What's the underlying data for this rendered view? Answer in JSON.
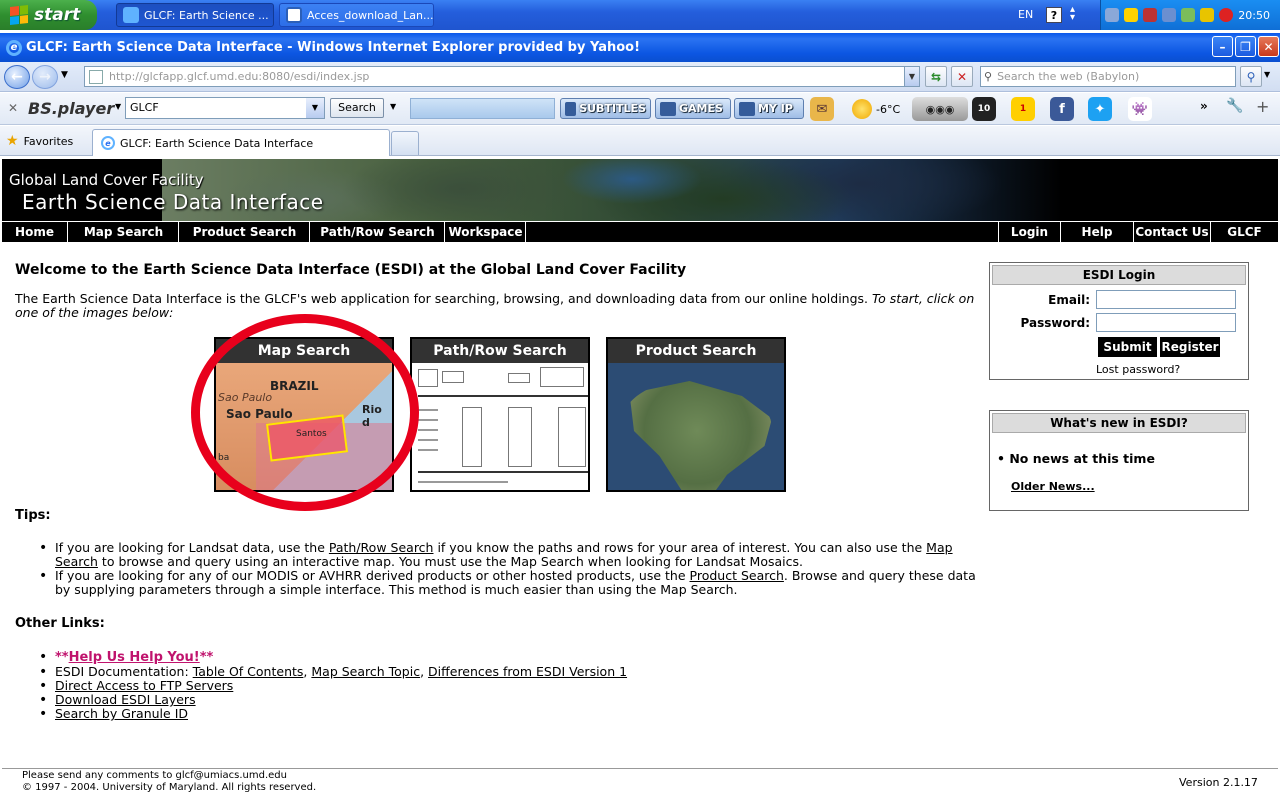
{
  "taskbar": {
    "start_label": "start",
    "buttons": [
      {
        "label": "GLCF: Earth Science ..."
      },
      {
        "label": "Acces_download_Lan..."
      }
    ],
    "language": "EN",
    "clock": "20:50"
  },
  "window": {
    "title": "GLCF: Earth Science Data Interface - Windows Internet Explorer provided by Yahoo!",
    "address": "http://glcfapp.glcf.umd.edu:8080/esdi/index.jsp",
    "web_search_placeholder": "Search the web (Babylon)",
    "tab_title": "GLCF: Earth Science Data Interface",
    "favorites_label": "Favorites"
  },
  "toolbar": {
    "player_label": "BS.player",
    "search_value": "GLCF",
    "search_button": "Search",
    "subtitles": "SUBTITLES",
    "games": "GAMES",
    "myip": "MY IP",
    "temperature": "-6°C",
    "badge1": "10",
    "badge2": "1"
  },
  "banner": {
    "line1": "Global Land Cover Facility",
    "line2": "Earth Science Data Interface"
  },
  "nav": {
    "left": [
      "Home",
      "Map Search",
      "Product Search",
      "Path/Row Search",
      "Workspace"
    ],
    "right": [
      "Login",
      "Help",
      "Contact Us",
      "GLCF"
    ]
  },
  "main": {
    "welcome": "Welcome to the Earth Science Data Interface (ESDI) at the Global Land Cover Facility",
    "intro": "The Earth Science Data Interface is the GLCF's web application for searching, browsing, and downloading data from our online holdings.",
    "intro_italic": "To start, click on one of the images below:",
    "thumbnails": {
      "map": "Map Search",
      "path": "Path/Row Search",
      "product": "Product Search"
    },
    "map_labels": {
      "brazil": "BRAZIL",
      "sao_paulo_small": "Sao Paulo",
      "sao_paulo": "Sao Paulo",
      "rio": "Rio d",
      "santos": "Santos",
      "ba": "ba"
    },
    "tips_heading": "Tips:",
    "tips": {
      "t1_a": "If you are looking for Landsat data, use the ",
      "t1_link1": "Path/Row Search",
      "t1_b": " if you know the paths and rows for your area of interest. You can also use the ",
      "t1_link2": "Map Search",
      "t1_c": " to browse and query using an interactive map. You must use the Map Search when looking for Landsat Mosaics.",
      "t2_a": "If you are looking for any of our MODIS or AVHRR derived products or other hosted products, use the ",
      "t2_link": "Product Search",
      "t2_b": ". Browse and query these data by supplying parameters through a simple interface. This method is much easier than using the Map Search."
    },
    "other_heading": "Other Links:",
    "links": {
      "help_prefix": "**",
      "help": "Help Us Help You!",
      "help_suffix": "**",
      "doc_label": "ESDI Documentation: ",
      "toc": "Table Of Contents",
      "map_topic": "Map Search Topic",
      "diff": "Differences from ESDI Version 1",
      "ftp": "Direct Access to FTP Servers",
      "layers": "Download ESDI Layers",
      "granule": "Search by Granule ID"
    }
  },
  "login": {
    "heading": "ESDI Login",
    "email_label": "Email:",
    "password_label": "Password:",
    "submit": "Submit",
    "register": "Register",
    "lost": "Lost password?"
  },
  "news": {
    "heading": "What's new in ESDI?",
    "item": "No news at this time",
    "older": "Older News..."
  },
  "footer": {
    "comments": "Please send any comments to glcf@umiacs.umd.edu",
    "copyright": "© 1997 - 2004. University of Maryland. All rights reserved.",
    "version": "Version 2.1.17"
  },
  "colors": {
    "accent_red_circle": "#e8001c",
    "help_link": "#c0136d",
    "nav_bg": "#000000"
  }
}
